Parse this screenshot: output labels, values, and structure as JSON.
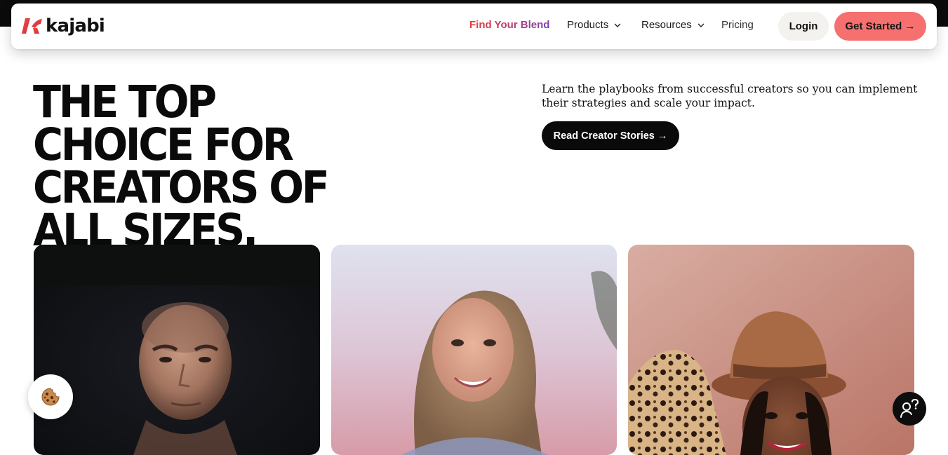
{
  "brand": {
    "name": "kajabi",
    "logo_icon": "kajabi-k-mark",
    "accent": "#e6403b"
  },
  "nav": {
    "links": [
      {
        "label": "Find Your Blend",
        "dropdown": false
      },
      {
        "label": "Products",
        "dropdown": true
      },
      {
        "label": "Resources",
        "dropdown": true
      },
      {
        "label": "Pricing",
        "dropdown": false
      }
    ],
    "login_label": "Login",
    "cta_label": "Get Started →",
    "cta_color": "#f6706f"
  },
  "hero": {
    "title": "THE TOP CHOICE FOR CREATORS OF ALL SIZES.",
    "subtitle": "Learn the playbooks from successful creators so you can implement their strategies and scale your impact.",
    "button_label": "Read Creator Stories →"
  },
  "cards": [
    {
      "photo": "creator-portrait-man-dark-background"
    },
    {
      "photo": "creator-portrait-woman-sunset"
    },
    {
      "photo": "creator-portrait-woman-brown-hat"
    }
  ],
  "widgets": {
    "cookie_icon": "cookie-icon",
    "help_icon": "help-chat-icon"
  }
}
